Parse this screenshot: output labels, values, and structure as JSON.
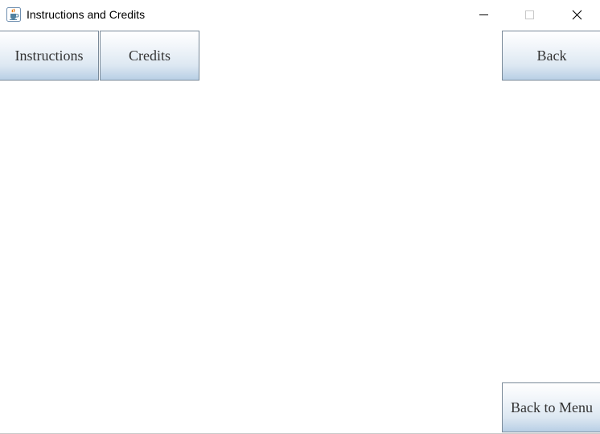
{
  "window": {
    "title": "Instructions and Credits",
    "app_icon": "java-coffee-cup-icon",
    "controls": {
      "minimize": "minimize-icon",
      "maximize": "maximize-icon",
      "close": "close-icon"
    }
  },
  "top_buttons": {
    "instructions_label": "Instructions",
    "credits_label": "Credits",
    "back_label": "Back"
  },
  "bottom_buttons": {
    "back_to_menu_label": "Back to Menu"
  },
  "colors": {
    "button_gradient_top": "#ffffff",
    "button_gradient_bottom": "#b8cfe5",
    "button_border": "#7a8a99",
    "background": "#ffffff"
  }
}
